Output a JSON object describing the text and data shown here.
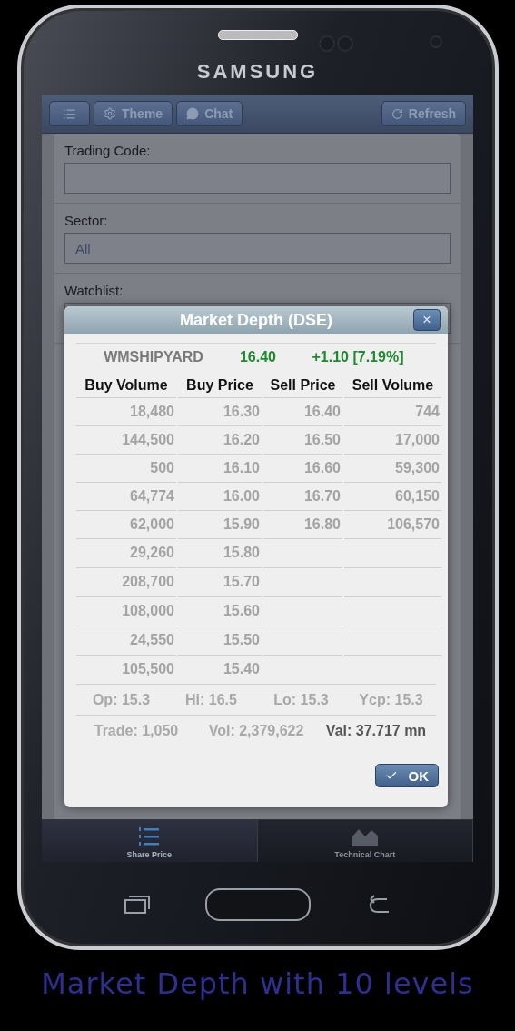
{
  "device": {
    "brand": "SAMSUNG"
  },
  "toolbar": {
    "buttons": [
      {
        "kind": "menu"
      },
      {
        "kind": "theme",
        "label": "Theme"
      },
      {
        "kind": "chat",
        "label": "Chat"
      }
    ],
    "refresh": {
      "label": "Refresh"
    }
  },
  "form": {
    "fields": [
      {
        "label": "Trading Code:"
      },
      {
        "label": "Sector:",
        "value": "All"
      },
      {
        "label": "Watchlist:"
      }
    ]
  },
  "dialog": {
    "title": "Market Depth (DSE)",
    "close": "×",
    "quote": {
      "symbol": "WMSHIPYARD",
      "price": "16.40",
      "change": "+1.10 [7.19%]"
    },
    "columns": [
      "Buy Volume",
      "Buy Price",
      "Sell Price",
      "Sell Volume"
    ],
    "rows": [
      [
        "18,480",
        "16.30",
        "16.40",
        "744"
      ],
      [
        "144,500",
        "16.20",
        "16.50",
        "17,000"
      ],
      [
        "500",
        "16.10",
        "16.60",
        "59,300"
      ],
      [
        "64,774",
        "16.00",
        "16.70",
        "60,150"
      ],
      [
        "62,000",
        "15.90",
        "16.80",
        "106,570"
      ],
      [
        "29,260",
        "15.80"
      ],
      [
        "208,700",
        "15.70"
      ],
      [
        "108,000",
        "15.60"
      ],
      [
        "24,550",
        "15.50"
      ],
      [
        "105,500",
        "15.40"
      ]
    ],
    "stats": [
      {
        "text": "Op: 15.3",
        "strong": false
      },
      {
        "text": "Hi: 16.5",
        "strong": false
      },
      {
        "text": "Lo: 15.3",
        "strong": false
      },
      {
        "text": "Ycp: 15.3",
        "strong": false
      }
    ],
    "totals": [
      {
        "text": "Trade: 1,050",
        "strong": false
      },
      {
        "text": "Vol: 2,379,622",
        "strong": false
      },
      {
        "text": "Val: 37.717 mn",
        "strong": true
      }
    ],
    "ok": "OK"
  },
  "nav": [
    {
      "kind": "list",
      "label": "Share Price",
      "selected": true
    },
    {
      "kind": "chart",
      "label": "Technical Chart",
      "selected": false
    }
  ],
  "caption": "Market Depth with 10 levels"
}
